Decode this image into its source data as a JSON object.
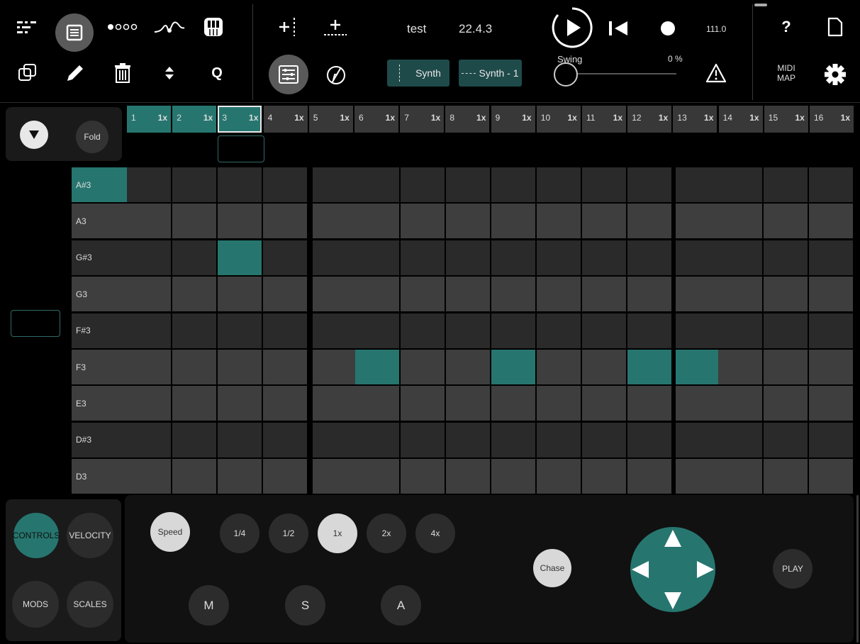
{
  "toolbar": {
    "song_name": "test",
    "version": "22.4.3",
    "tempo": "111.0",
    "synth_label": "Synth",
    "pattern_label": "Synth - 1",
    "swing_label": "Swing",
    "swing_value": "0 %",
    "quantize_label": "Q",
    "midi_map_line1": "MIDI",
    "midi_map_line2": "MAP",
    "help_label": "?"
  },
  "steps_panel": {
    "fold_label": "Fold"
  },
  "steps": [
    {
      "num": "1",
      "mult": "1x",
      "state": "active"
    },
    {
      "num": "2",
      "mult": "1x",
      "state": "active"
    },
    {
      "num": "3",
      "mult": "1x",
      "state": "current"
    },
    {
      "num": "4",
      "mult": "1x",
      "state": ""
    },
    {
      "num": "5",
      "mult": "1x",
      "state": ""
    },
    {
      "num": "6",
      "mult": "1x",
      "state": ""
    },
    {
      "num": "7",
      "mult": "1x",
      "state": ""
    },
    {
      "num": "8",
      "mult": "1x",
      "state": ""
    },
    {
      "num": "9",
      "mult": "1x",
      "state": ""
    },
    {
      "num": "10",
      "mult": "1x",
      "state": ""
    },
    {
      "num": "11",
      "mult": "1x",
      "state": ""
    },
    {
      "num": "12",
      "mult": "1x",
      "state": ""
    },
    {
      "num": "13",
      "mult": "1x",
      "state": ""
    },
    {
      "num": "14",
      "mult": "1x",
      "state": ""
    },
    {
      "num": "15",
      "mult": "1x",
      "state": ""
    },
    {
      "num": "16",
      "mult": "1x",
      "state": ""
    }
  ],
  "keys": [
    {
      "label": "A#3",
      "shade": "dark",
      "selected": true
    },
    {
      "label": "A3",
      "shade": "light",
      "selected": false
    },
    {
      "label": "G#3",
      "shade": "dark",
      "selected": false
    },
    {
      "label": "G3",
      "shade": "light",
      "selected": false
    },
    {
      "label": "F#3",
      "shade": "dark",
      "selected": false
    },
    {
      "label": "F3",
      "shade": "light",
      "selected": false
    },
    {
      "label": "E3",
      "shade": "light",
      "selected": false
    },
    {
      "label": "D#3",
      "shade": "dark",
      "selected": false
    },
    {
      "label": "D3",
      "shade": "light",
      "selected": false
    }
  ],
  "notes": [
    {
      "row": 2,
      "step": 3
    },
    {
      "row": 5,
      "step": 6
    },
    {
      "row": 5,
      "step": 9
    },
    {
      "row": 5,
      "step": 12
    },
    {
      "row": 5,
      "step": 13
    }
  ],
  "bottom_left": {
    "controls_label": "CONTROLS",
    "velocity_label": "VELOCITY",
    "mods_label": "MODS",
    "scales_label": "SCALES"
  },
  "bottom_main": {
    "speed_label": "Speed",
    "speed_options": [
      "1/4",
      "1/2",
      "1x",
      "2x",
      "4x"
    ],
    "selected_speed": "1x",
    "mute_label": "M",
    "solo_label": "S",
    "arm_label": "A",
    "chase_label": "Chase",
    "play_label": "PLAY"
  },
  "colors": {
    "accent": "#26766f",
    "cell_dark": "#2a2a2a",
    "cell_light": "#3e3e3e"
  }
}
